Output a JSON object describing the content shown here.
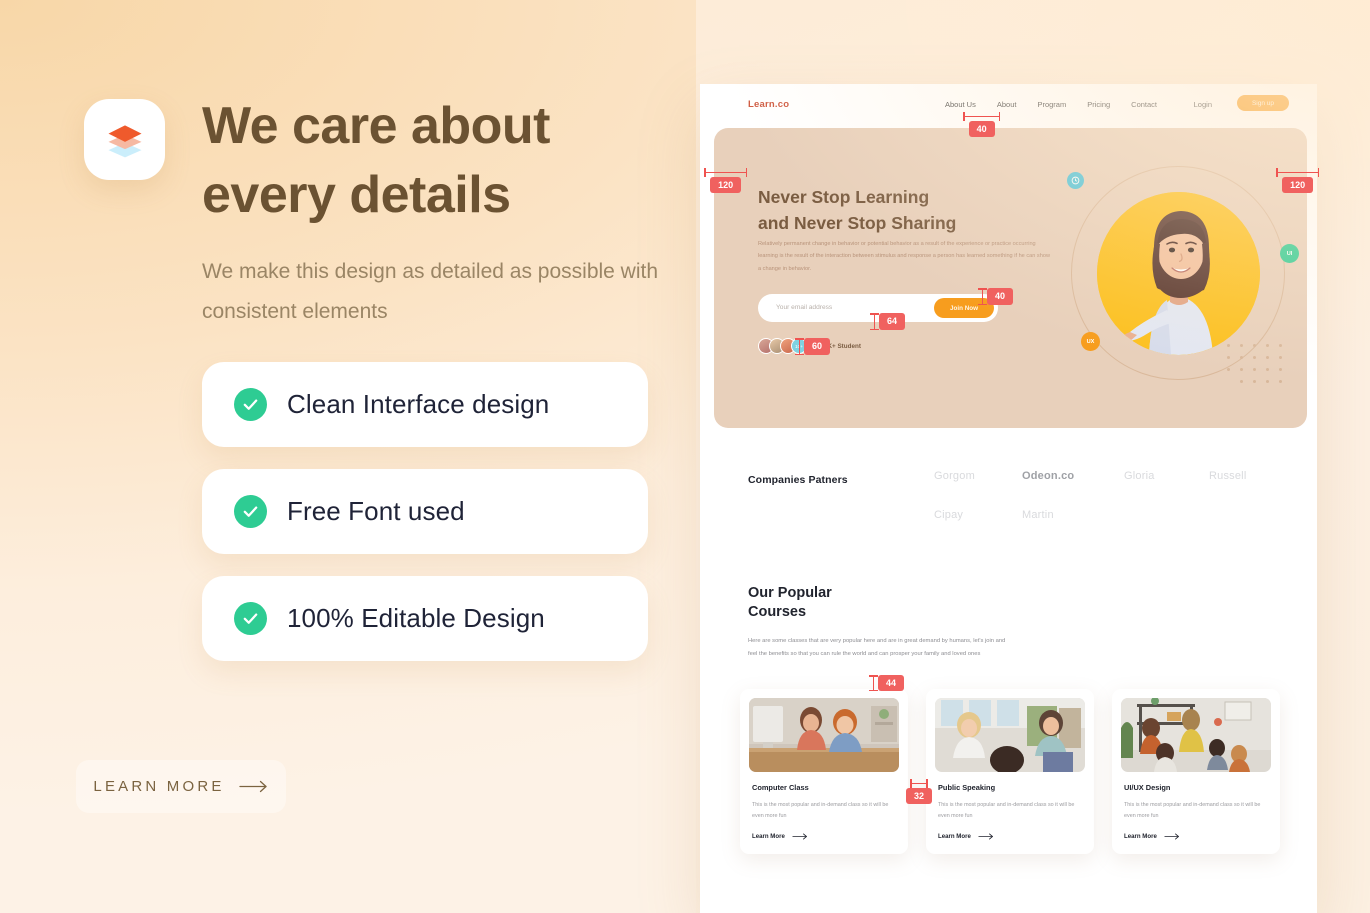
{
  "left": {
    "logo_icon": "layers-icon",
    "headline_line1": "We care about",
    "headline_line2": "every details",
    "subhead": "We make this design as detailed as possible with consistent elements",
    "features": [
      {
        "label": "Clean Interface design",
        "icon": "check-circle-icon"
      },
      {
        "label": "Free Font used",
        "icon": "check-circle-icon"
      },
      {
        "label": "100% Editable Design",
        "icon": "check-circle-icon"
      }
    ],
    "cta": {
      "label": "LEARN MORE",
      "icon": "arrow-right-icon"
    }
  },
  "mockup": {
    "nav": {
      "brand": "Learn.co",
      "links": [
        "About Us",
        "About",
        "Program",
        "Pricing",
        "Contact"
      ],
      "login": "Login",
      "signup": "Sign up"
    },
    "hero": {
      "title_line1": "Never Stop Learning",
      "title_line2": "and Never Stop Sharing",
      "paragraph": "Relatively permanent change in behavior or potential behavior as a result of the experience or practice occurring learning is the result of the interaction between stimulus and response a person has learned something if he can show a change in behavior.",
      "email_placeholder": "Your email address",
      "join_button": "Join Now",
      "students_badge": "10+",
      "students_label": "120K+ Student",
      "badges": [
        {
          "name": "clock-badge",
          "label": ""
        },
        {
          "name": "ui-badge",
          "label": "UI"
        },
        {
          "name": "ux-badge",
          "label": "UX"
        }
      ]
    },
    "partners": {
      "title": "Companies Patners",
      "items": [
        {
          "name": "Gorgom",
          "bold": false
        },
        {
          "name": "Odeon.co",
          "bold": true
        },
        {
          "name": "Gloria",
          "bold": false
        },
        {
          "name": "Russell",
          "bold": false
        },
        {
          "name": "Cipay",
          "bold": false
        },
        {
          "name": "Martin",
          "bold": false
        }
      ]
    },
    "courses": {
      "title_line1": "Our Popular",
      "title_line2": "Courses",
      "paragraph": "Here are some classes that are very popular here and are in great demand by humans, let's join and feel the benefits so that you can rule the world and can prosper your family and loved ones",
      "cards": [
        {
          "title": "Computer Class",
          "description": "This is the most popular and in-demand class so it will be even more fun",
          "link": "Learn More"
        },
        {
          "title": "Public Speaking",
          "description": "This is the most popular and in-demand class so it will be even more fun",
          "link": "Learn More"
        },
        {
          "title": "UI/UX Design",
          "description": "This is the most popular and in-demand class so it will be even more fun",
          "link": "Learn More"
        }
      ]
    }
  },
  "annotations": {
    "nav_gap": "40",
    "hero_left": "120",
    "hero_right": "120",
    "form_right": "40",
    "form_height": "64",
    "students_gap": "60",
    "cards_top": "44",
    "cards_gap": "32"
  },
  "colors": {
    "brand": "#cf5c43",
    "accent_orange": "#f79d1e",
    "accent_green": "#2ecc93",
    "accent_teal": "#4fc3d9",
    "annotation_red": "#f0615f",
    "headline_brown": "#6b5232",
    "hero_bg": "#e8d0bb",
    "yellow": "#fcc01e"
  }
}
